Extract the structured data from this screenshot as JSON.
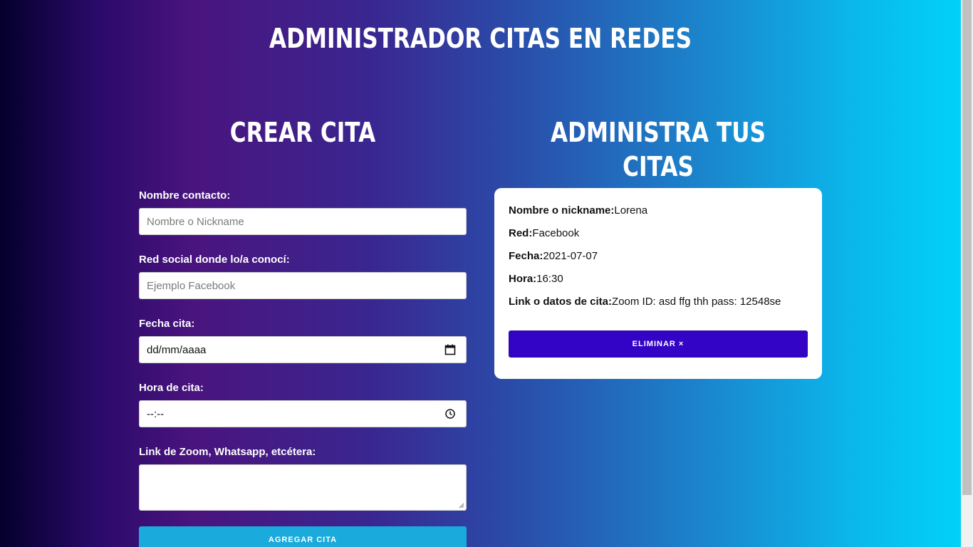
{
  "header": {
    "title": "Administrador citas en redes"
  },
  "left": {
    "title": "Crear cita",
    "form": {
      "name_label": "Nombre contacto:",
      "name_placeholder": "Nombre o Nickname",
      "social_label": "Red social donde lo/a conocí:",
      "social_placeholder": "Ejemplo Facebook",
      "date_label": "Fecha cita:",
      "date_value": "dd/mm/aaaa",
      "time_label": "Hora de cita:",
      "time_value": "--:--",
      "link_label": "Link de Zoom, Whatsapp, etcétera:",
      "submit_label": "Agregar cita"
    }
  },
  "right": {
    "title": "Administra tus citas",
    "appointments": [
      {
        "nickname_label": "Nombre o nickname:",
        "nickname": "Lorena",
        "network_label": "Red:",
        "network": "Facebook",
        "date_label": "Fecha:",
        "date": "2021-07-07",
        "time_label": "Hora:",
        "time": "16:30",
        "link_label": "Link o datos de cita:",
        "link": "Zoom ID: asd ffg thh pass: 12548se",
        "delete_label": "Eliminar ×"
      }
    ]
  },
  "colors": {
    "submit_button": "#1aaadb",
    "delete_button": "#3303c6",
    "gradient_start": "#04002b",
    "gradient_end": "#00d4fb"
  }
}
